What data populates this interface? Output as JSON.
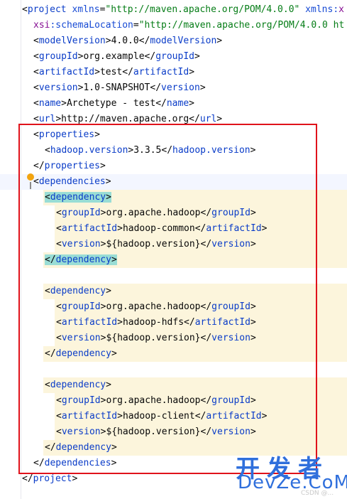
{
  "editor": {
    "language": "xml",
    "lines": [
      {
        "segments": [
          {
            "t": "<",
            "c": "brk"
          },
          {
            "t": "project",
            "c": "tag"
          },
          {
            "t": " xmlns",
            "c": "attr"
          },
          {
            "t": "=",
            "c": "brk"
          },
          {
            "t": "\"http://maven.apache.org/POM/4.0.0\"",
            "c": "str"
          },
          {
            "t": " xmlns:",
            "c": "attr"
          },
          {
            "t": "x",
            "c": "ns"
          }
        ],
        "indent": 0
      },
      {
        "segments": [
          {
            "t": "xsi",
            "c": "ns"
          },
          {
            "t": ":schemaLocation",
            "c": "attr"
          },
          {
            "t": "=",
            "c": "brk"
          },
          {
            "t": "\"http://maven.apache.org/POM/4.0.0 ht",
            "c": "str"
          }
        ],
        "indent": 1
      },
      {
        "segments": [
          {
            "t": "<",
            "c": "brk"
          },
          {
            "t": "modelVersion",
            "c": "tag"
          },
          {
            "t": ">",
            "c": "brk"
          },
          {
            "t": "4.0.0",
            "c": "txt"
          },
          {
            "t": "</",
            "c": "brk"
          },
          {
            "t": "modelVersion",
            "c": "tag"
          },
          {
            "t": ">",
            "c": "brk"
          }
        ],
        "indent": 1
      },
      {
        "segments": [
          {
            "t": "<",
            "c": "brk"
          },
          {
            "t": "groupId",
            "c": "tag"
          },
          {
            "t": ">",
            "c": "brk"
          },
          {
            "t": "org.example",
            "c": "txt"
          },
          {
            "t": "</",
            "c": "brk"
          },
          {
            "t": "groupId",
            "c": "tag"
          },
          {
            "t": ">",
            "c": "brk"
          }
        ],
        "indent": 1
      },
      {
        "segments": [
          {
            "t": "<",
            "c": "brk"
          },
          {
            "t": "artifactId",
            "c": "tag"
          },
          {
            "t": ">",
            "c": "brk"
          },
          {
            "t": "test",
            "c": "txt"
          },
          {
            "t": "</",
            "c": "brk"
          },
          {
            "t": "artifactId",
            "c": "tag"
          },
          {
            "t": ">",
            "c": "brk"
          }
        ],
        "indent": 1
      },
      {
        "segments": [
          {
            "t": "<",
            "c": "brk"
          },
          {
            "t": "version",
            "c": "tag"
          },
          {
            "t": ">",
            "c": "brk"
          },
          {
            "t": "1.0-SNAPSHOT",
            "c": "txt"
          },
          {
            "t": "</",
            "c": "brk"
          },
          {
            "t": "version",
            "c": "tag"
          },
          {
            "t": ">",
            "c": "brk"
          }
        ],
        "indent": 1
      },
      {
        "segments": [
          {
            "t": "<",
            "c": "brk"
          },
          {
            "t": "name",
            "c": "tag"
          },
          {
            "t": ">",
            "c": "brk"
          },
          {
            "t": "Archetype - test",
            "c": "txt"
          },
          {
            "t": "</",
            "c": "brk"
          },
          {
            "t": "name",
            "c": "tag"
          },
          {
            "t": ">",
            "c": "brk"
          }
        ],
        "indent": 1
      },
      {
        "segments": [
          {
            "t": "<",
            "c": "brk"
          },
          {
            "t": "url",
            "c": "tag"
          },
          {
            "t": ">",
            "c": "brk"
          },
          {
            "t": "http://maven.apache.org",
            "c": "txt"
          },
          {
            "t": "</",
            "c": "brk"
          },
          {
            "t": "url",
            "c": "tag"
          },
          {
            "t": ">",
            "c": "brk"
          }
        ],
        "indent": 1
      },
      {
        "segments": [
          {
            "t": "<",
            "c": "brk"
          },
          {
            "t": "properties",
            "c": "tag"
          },
          {
            "t": ">",
            "c": "brk"
          }
        ],
        "indent": 1
      },
      {
        "segments": [
          {
            "t": "<",
            "c": "brk"
          },
          {
            "t": "hadoop.version",
            "c": "tag"
          },
          {
            "t": ">",
            "c": "brk"
          },
          {
            "t": "3.3.5",
            "c": "txt"
          },
          {
            "t": "</",
            "c": "brk"
          },
          {
            "t": "hadoop.version",
            "c": "tag"
          },
          {
            "t": ">",
            "c": "brk"
          }
        ],
        "indent": 2
      },
      {
        "segments": [
          {
            "t": "</",
            "c": "brk"
          },
          {
            "t": "properties",
            "c": "tag"
          },
          {
            "t": ">",
            "c": "brk"
          }
        ],
        "indent": 1
      },
      {
        "segments": [
          {
            "t": "<",
            "c": "brk"
          },
          {
            "t": "dependencies",
            "c": "tag"
          },
          {
            "t": ">",
            "c": "brk"
          }
        ],
        "indent": 1,
        "caret": true
      },
      {
        "segments": [
          {
            "t": "<",
            "c": "brk"
          },
          {
            "t": "dependency",
            "c": "tag"
          },
          {
            "t": ">",
            "c": "brk"
          }
        ],
        "indent": 2,
        "hl": true,
        "matched": true
      },
      {
        "segments": [
          {
            "t": "<",
            "c": "brk"
          },
          {
            "t": "groupId",
            "c": "tag"
          },
          {
            "t": ">",
            "c": "brk"
          },
          {
            "t": "org.apache.hadoop",
            "c": "txt"
          },
          {
            "t": "</",
            "c": "brk"
          },
          {
            "t": "groupId",
            "c": "tag"
          },
          {
            "t": ">",
            "c": "brk"
          }
        ],
        "indent": 3,
        "hl": true
      },
      {
        "segments": [
          {
            "t": "<",
            "c": "brk"
          },
          {
            "t": "artifactId",
            "c": "tag"
          },
          {
            "t": ">",
            "c": "brk"
          },
          {
            "t": "hadoop-common",
            "c": "txt"
          },
          {
            "t": "</",
            "c": "brk"
          },
          {
            "t": "artifactId",
            "c": "tag"
          },
          {
            "t": ">",
            "c": "brk"
          }
        ],
        "indent": 3,
        "hl": true
      },
      {
        "segments": [
          {
            "t": "<",
            "c": "brk"
          },
          {
            "t": "version",
            "c": "tag"
          },
          {
            "t": ">",
            "c": "brk"
          },
          {
            "t": "${hadoop.version}",
            "c": "txt"
          },
          {
            "t": "</",
            "c": "brk"
          },
          {
            "t": "version",
            "c": "tag"
          },
          {
            "t": ">",
            "c": "brk"
          }
        ],
        "indent": 3,
        "hl": true
      },
      {
        "segments": [
          {
            "t": "</",
            "c": "brk"
          },
          {
            "t": "dependency",
            "c": "tag"
          },
          {
            "t": ">",
            "c": "brk"
          }
        ],
        "indent": 2,
        "hl": true,
        "matched": true
      },
      {
        "segments": [],
        "indent": 0
      },
      {
        "segments": [
          {
            "t": "<",
            "c": "brk"
          },
          {
            "t": "dependency",
            "c": "tag"
          },
          {
            "t": ">",
            "c": "brk"
          }
        ],
        "indent": 2,
        "hl": true
      },
      {
        "segments": [
          {
            "t": "<",
            "c": "brk"
          },
          {
            "t": "groupId",
            "c": "tag"
          },
          {
            "t": ">",
            "c": "brk"
          },
          {
            "t": "org.apache.hadoop",
            "c": "txt"
          },
          {
            "t": "</",
            "c": "brk"
          },
          {
            "t": "groupId",
            "c": "tag"
          },
          {
            "t": ">",
            "c": "brk"
          }
        ],
        "indent": 3,
        "hl": true
      },
      {
        "segments": [
          {
            "t": "<",
            "c": "brk"
          },
          {
            "t": "artifactId",
            "c": "tag"
          },
          {
            "t": ">",
            "c": "brk"
          },
          {
            "t": "hadoop-hdfs",
            "c": "txt"
          },
          {
            "t": "</",
            "c": "brk"
          },
          {
            "t": "artifactId",
            "c": "tag"
          },
          {
            "t": ">",
            "c": "brk"
          }
        ],
        "indent": 3,
        "hl": true
      },
      {
        "segments": [
          {
            "t": "<",
            "c": "brk"
          },
          {
            "t": "version",
            "c": "tag"
          },
          {
            "t": ">",
            "c": "brk"
          },
          {
            "t": "${hadoop.version}",
            "c": "txt"
          },
          {
            "t": "</",
            "c": "brk"
          },
          {
            "t": "version",
            "c": "tag"
          },
          {
            "t": ">",
            "c": "brk"
          }
        ],
        "indent": 3,
        "hl": true
      },
      {
        "segments": [
          {
            "t": "</",
            "c": "brk"
          },
          {
            "t": "dependency",
            "c": "tag"
          },
          {
            "t": ">",
            "c": "brk"
          }
        ],
        "indent": 2,
        "hl": true
      },
      {
        "segments": [],
        "indent": 0
      },
      {
        "segments": [
          {
            "t": "<",
            "c": "brk"
          },
          {
            "t": "dependency",
            "c": "tag"
          },
          {
            "t": ">",
            "c": "brk"
          }
        ],
        "indent": 2,
        "hl": true
      },
      {
        "segments": [
          {
            "t": "<",
            "c": "brk"
          },
          {
            "t": "groupId",
            "c": "tag"
          },
          {
            "t": ">",
            "c": "brk"
          },
          {
            "t": "org.apache.hadoop",
            "c": "txt"
          },
          {
            "t": "</",
            "c": "brk"
          },
          {
            "t": "groupId",
            "c": "tag"
          },
          {
            "t": ">",
            "c": "brk"
          }
        ],
        "indent": 3,
        "hl": true
      },
      {
        "segments": [
          {
            "t": "<",
            "c": "brk"
          },
          {
            "t": "artifactId",
            "c": "tag"
          },
          {
            "t": ">",
            "c": "brk"
          },
          {
            "t": "hadoop-client",
            "c": "txt"
          },
          {
            "t": "</",
            "c": "brk"
          },
          {
            "t": "artifactId",
            "c": "tag"
          },
          {
            "t": ">",
            "c": "brk"
          }
        ],
        "indent": 3,
        "hl": true
      },
      {
        "segments": [
          {
            "t": "<",
            "c": "brk"
          },
          {
            "t": "version",
            "c": "tag"
          },
          {
            "t": ">",
            "c": "brk"
          },
          {
            "t": "${hadoop.version}",
            "c": "txt"
          },
          {
            "t": "</",
            "c": "brk"
          },
          {
            "t": "version",
            "c": "tag"
          },
          {
            "t": ">",
            "c": "brk"
          }
        ],
        "indent": 3,
        "hl": true
      },
      {
        "segments": [
          {
            "t": "</",
            "c": "brk"
          },
          {
            "t": "dependency",
            "c": "tag"
          },
          {
            "t": ">",
            "c": "brk"
          }
        ],
        "indent": 2,
        "hl": true
      },
      {
        "segments": [
          {
            "t": "</",
            "c": "brk"
          },
          {
            "t": "dependencies",
            "c": "tag"
          },
          {
            "t": ">",
            "c": "brk"
          }
        ],
        "indent": 1
      },
      {
        "segments": [
          {
            "t": "</",
            "c": "brk"
          },
          {
            "t": "project",
            "c": "tag"
          },
          {
            "t": ">",
            "c": "brk"
          }
        ],
        "indent": 0
      }
    ]
  },
  "annotation": {
    "selection_color": "#e0121b"
  },
  "icons": {
    "intention_bulb": "lightbulb-icon",
    "fold_marker": "fold-icon"
  },
  "watermark": {
    "cn": "开发者",
    "en": "DevZe.CoM",
    "sub": "CSDN @..."
  }
}
